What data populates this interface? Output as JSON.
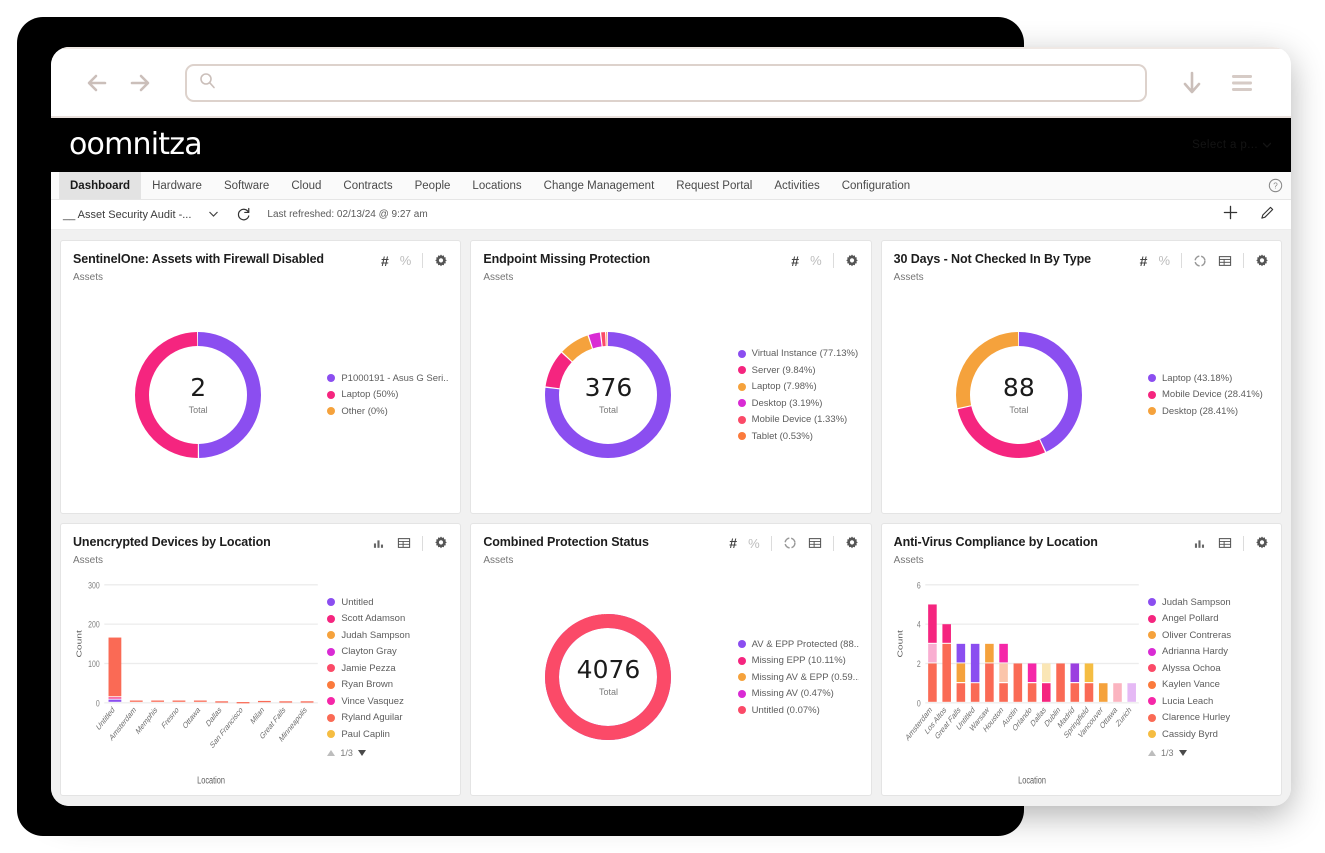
{
  "browser": {
    "back_icon": "arrow-left-icon",
    "forward_icon": "arrow-right-icon",
    "search_icon": "search-icon",
    "url_value": "",
    "url_placeholder": "",
    "download_icon": "download-arrow-icon",
    "menu_icon": "hamburger-menu-icon"
  },
  "app_header": {
    "brand": "oomnitza",
    "profile_selector": "Select a p..."
  },
  "nav": {
    "items": [
      {
        "label": "Dashboard",
        "active": true
      },
      {
        "label": "Hardware",
        "active": false
      },
      {
        "label": "Software",
        "active": false
      },
      {
        "label": "Cloud",
        "active": false
      },
      {
        "label": "Contracts",
        "active": false
      },
      {
        "label": "People",
        "active": false
      },
      {
        "label": "Locations",
        "active": false
      },
      {
        "label": "Change Management",
        "active": false
      },
      {
        "label": "Request Portal",
        "active": false
      },
      {
        "label": "Activities",
        "active": false
      },
      {
        "label": "Configuration",
        "active": false
      }
    ],
    "help_icon": "question-mark-circle-icon"
  },
  "dash_bar": {
    "dashboard_name": "__ Asset Security Audit -...",
    "caret_icon": "chevron-down-icon",
    "refresh_icon": "refresh-icon",
    "last_refreshed": "Last refreshed: 02/13/24 @ 9:27 am",
    "add_icon": "plus-icon",
    "edit_icon": "pencil-icon"
  },
  "colors": {
    "purple": "#8b4ef0",
    "pink": "#f5257f",
    "orange": "#f5a23c",
    "magenta": "#d92bd4",
    "rose": "#fb4a68",
    "coral": "#fb6a52",
    "hotpink": "#f527a8",
    "salmon": "#fa6a55",
    "amber": "#f5bd42",
    "light_pink": "#f9aed1",
    "light_peach": "#fbc5ab",
    "light_cream": "#fae6b5",
    "light_lilac": "#e5b9f5",
    "light_rose": "#fbb4c0",
    "card_bg": "#ffffff",
    "page_bg": "#f1f1f1",
    "header_bg": "#000000"
  },
  "cards": [
    {
      "id": "sentinelone-firewall-disabled",
      "title": "SentinelOne: Assets with Firewall Disabled",
      "subtitle": "Assets",
      "icons": [
        "hash-icon",
        "percent-icon",
        "gear-icon"
      ],
      "chart_data": {
        "type": "pie",
        "title": "SentinelOne: Assets with Firewall Disabled",
        "total": "2",
        "total_label": "Total",
        "labels": [
          "P1000191 - Asus G Seri...",
          "Laptop (50%)",
          "Other (0%)"
        ],
        "values": [
          50,
          50,
          0
        ],
        "colors": [
          "#8b4ef0",
          "#f5257f",
          "#f5a23c"
        ],
        "legend_position": "right"
      }
    },
    {
      "id": "endpoint-missing-protection",
      "title": "Endpoint Missing Protection",
      "subtitle": "Assets",
      "icons": [
        "hash-icon",
        "percent-icon",
        "gear-icon"
      ],
      "chart_data": {
        "type": "pie",
        "title": "Endpoint Missing Protection",
        "total": "376",
        "total_label": "Total",
        "labels": [
          "Virtual Instance (77.13%)",
          "Server (9.84%)",
          "Laptop (7.98%)",
          "Desktop (3.19%)",
          "Mobile Device (1.33%)",
          "Tablet (0.53%)"
        ],
        "values": [
          77.13,
          9.84,
          7.98,
          3.19,
          1.33,
          0.53
        ],
        "colors": [
          "#8b4ef0",
          "#f5257f",
          "#f5a23c",
          "#d92bd4",
          "#fb4a68",
          "#fb7a3c"
        ],
        "legend_position": "right"
      }
    },
    {
      "id": "30-days-not-checked-in-by-type",
      "title": "30 Days - Not Checked In By Type",
      "subtitle": "Assets",
      "icons": [
        "hash-icon",
        "percent-icon",
        "donut-icon",
        "table-icon",
        "gear-icon"
      ],
      "chart_data": {
        "type": "pie",
        "title": "30 Days - Not Checked In By Type",
        "total": "88",
        "total_label": "Total",
        "labels": [
          "Laptop (43.18%)",
          "Mobile Device (28.41%)",
          "Desktop (28.41%)"
        ],
        "values": [
          43.18,
          28.41,
          28.41
        ],
        "colors": [
          "#8b4ef0",
          "#f5257f",
          "#f5a23c"
        ],
        "legend_position": "right"
      }
    },
    {
      "id": "unencrypted-devices-by-location",
      "title": "Unencrypted Devices by Location",
      "subtitle": "Assets",
      "icons": [
        "bar-chart-icon",
        "table-icon",
        "gear-icon"
      ],
      "legend_pager": "1/3",
      "chart_data": {
        "type": "bar",
        "title": "Unencrypted Devices by Location",
        "xlabel": "Location",
        "ylabel": "Count",
        "ylim": [
          0,
          300
        ],
        "yticks": [
          0,
          100,
          200,
          300
        ],
        "grid": true,
        "categories": [
          "Untitled",
          "Amsterdam",
          "Memphis",
          "Fresno",
          "Ottawa",
          "Dallas",
          "San Francisco",
          "Milan",
          "Great Falls",
          "Minneapolis"
        ],
        "series": [
          {
            "name": "Untitled",
            "color": "#8b4ef0",
            "values": [
              8,
              0,
              0,
              0,
              0,
              0,
              0,
              0,
              0,
              0
            ]
          },
          {
            "name": "Scott Adamson",
            "color": "#f5257f",
            "values": [
              6,
              0,
              0,
              0,
              0,
              0,
              0,
              0,
              0,
              0
            ]
          },
          {
            "name": "Judah Sampson",
            "color": "#f5a23c",
            "values": [
              0,
              0,
              0,
              0,
              0,
              0,
              0,
              0,
              0,
              0
            ]
          },
          {
            "name": "Clayton Gray",
            "color": "#d92bd4",
            "values": [
              0,
              0,
              0,
              0,
              0,
              0,
              0,
              0,
              0,
              0
            ]
          },
          {
            "name": "Jamie Pezza",
            "color": "#fb4a68",
            "values": [
              0,
              0,
              0,
              0,
              0,
              0,
              0,
              0,
              0,
              0
            ]
          },
          {
            "name": "Ryan Brown",
            "color": "#fb7a3c",
            "values": [
              0,
              0,
              0,
              0,
              0,
              0,
              0,
              0,
              0,
              0
            ]
          },
          {
            "name": "Vince Vasquez",
            "color": "#f527a8",
            "values": [
              0,
              0,
              0,
              0,
              0,
              0,
              0,
              0,
              0,
              0
            ]
          },
          {
            "name": "Ryland Aguilar",
            "color": "#fa6a55",
            "values": [
              152,
              6,
              6,
              6,
              6,
              4,
              2,
              5,
              4,
              4
            ]
          },
          {
            "name": "Paul Caplin",
            "color": "#f5bd42",
            "values": [
              0,
              0,
              0,
              0,
              0,
              0,
              0,
              0,
              0,
              0
            ]
          }
        ],
        "legend_position": "right"
      }
    },
    {
      "id": "combined-protection-status",
      "title": "Combined Protection Status",
      "subtitle": "Assets",
      "icons": [
        "hash-icon",
        "percent-icon",
        "donut-icon",
        "table-icon",
        "gear-icon"
      ],
      "chart_data": {
        "type": "pie",
        "title": "Combined Protection Status",
        "total": "4076",
        "total_label": "Total",
        "labels": [
          "AV & EPP Protected (88...",
          "Missing EPP (10.11%)",
          "Missing AV & EPP (0.59...",
          "Missing AV (0.47%)",
          "Untitled (0.07%)"
        ],
        "values": [
          88.76,
          10.11,
          0.59,
          0.47,
          0.07
        ],
        "colors": [
          "#8b4ef0",
          "#f5257f",
          "#f5a23c",
          "#d92bd4",
          "#fb4a68"
        ],
        "legend_position": "right"
      }
    },
    {
      "id": "anti-virus-compliance-by-location",
      "title": "Anti-Virus Compliance by Location",
      "subtitle": "Assets",
      "icons": [
        "bar-chart-icon",
        "table-icon",
        "gear-icon"
      ],
      "legend_pager": "1/3",
      "chart_data": {
        "type": "bar",
        "title": "Anti-Virus Compliance by Location",
        "xlabel": "Location",
        "ylabel": "Count",
        "ylim": [
          0,
          6
        ],
        "yticks": [
          0,
          2,
          4,
          6
        ],
        "grid": true,
        "categories": [
          "Amsterdam",
          "Los Altos",
          "Great Falls",
          "Untitled",
          "Warsaw",
          "Houston",
          "Austin",
          "Orlando",
          "Dallas",
          "Dublin",
          "Madrid",
          "Springfield",
          "Vancouver",
          "Ottawa",
          "Zurich"
        ],
        "stacks": [
          [
            {
              "c": "#fa6a55",
              "v": 2
            },
            {
              "c": "#f9aed1",
              "v": 1
            },
            {
              "c": "#f5257f",
              "v": 2
            }
          ],
          [
            {
              "c": "#fa6a55",
              "v": 3
            },
            {
              "c": "#f5257f",
              "v": 1
            }
          ],
          [
            {
              "c": "#fa6a55",
              "v": 1
            },
            {
              "c": "#f5a23c",
              "v": 1
            },
            {
              "c": "#8b4ef0",
              "v": 1
            }
          ],
          [
            {
              "c": "#fa6a55",
              "v": 1
            },
            {
              "c": "#8b4ef0",
              "v": 2
            }
          ],
          [
            {
              "c": "#fa6a55",
              "v": 2
            },
            {
              "c": "#f5a23c",
              "v": 1
            }
          ],
          [
            {
              "c": "#fa6a55",
              "v": 1
            },
            {
              "c": "#fbc5ab",
              "v": 1
            },
            {
              "c": "#f527a8",
              "v": 1
            }
          ],
          [
            {
              "c": "#fa6a55",
              "v": 2
            }
          ],
          [
            {
              "c": "#fa6a55",
              "v": 1
            },
            {
              "c": "#f527a8",
              "v": 1
            }
          ],
          [
            {
              "c": "#f5257f",
              "v": 1
            },
            {
              "c": "#fae6b5",
              "v": 1
            }
          ],
          [
            {
              "c": "#fa6a55",
              "v": 2
            }
          ],
          [
            {
              "c": "#fa6a55",
              "v": 1
            },
            {
              "c": "#9b3fe0",
              "v": 1
            }
          ],
          [
            {
              "c": "#fa6a55",
              "v": 1
            },
            {
              "c": "#f5bd42",
              "v": 1
            }
          ],
          [
            {
              "c": "#f5a23c",
              "v": 1
            }
          ],
          [
            {
              "c": "#fbb4c0",
              "v": 1
            }
          ],
          [
            {
              "c": "#e5b9f5",
              "v": 1
            }
          ]
        ],
        "legend": [
          {
            "name": "Judah Sampson",
            "color": "#8b4ef0"
          },
          {
            "name": "Angel Pollard",
            "color": "#f5257f"
          },
          {
            "name": "Oliver Contreras",
            "color": "#f5a23c"
          },
          {
            "name": "Adrianna Hardy",
            "color": "#d92bd4"
          },
          {
            "name": "Alyssa Ochoa",
            "color": "#fb4a68"
          },
          {
            "name": "Kaylen Vance",
            "color": "#fb7a3c"
          },
          {
            "name": "Lucia Leach",
            "color": "#f527a8"
          },
          {
            "name": "Clarence Hurley",
            "color": "#fa6a55"
          },
          {
            "name": "Cassidy Byrd",
            "color": "#f5bd42"
          }
        ],
        "legend_position": "right"
      }
    }
  ]
}
